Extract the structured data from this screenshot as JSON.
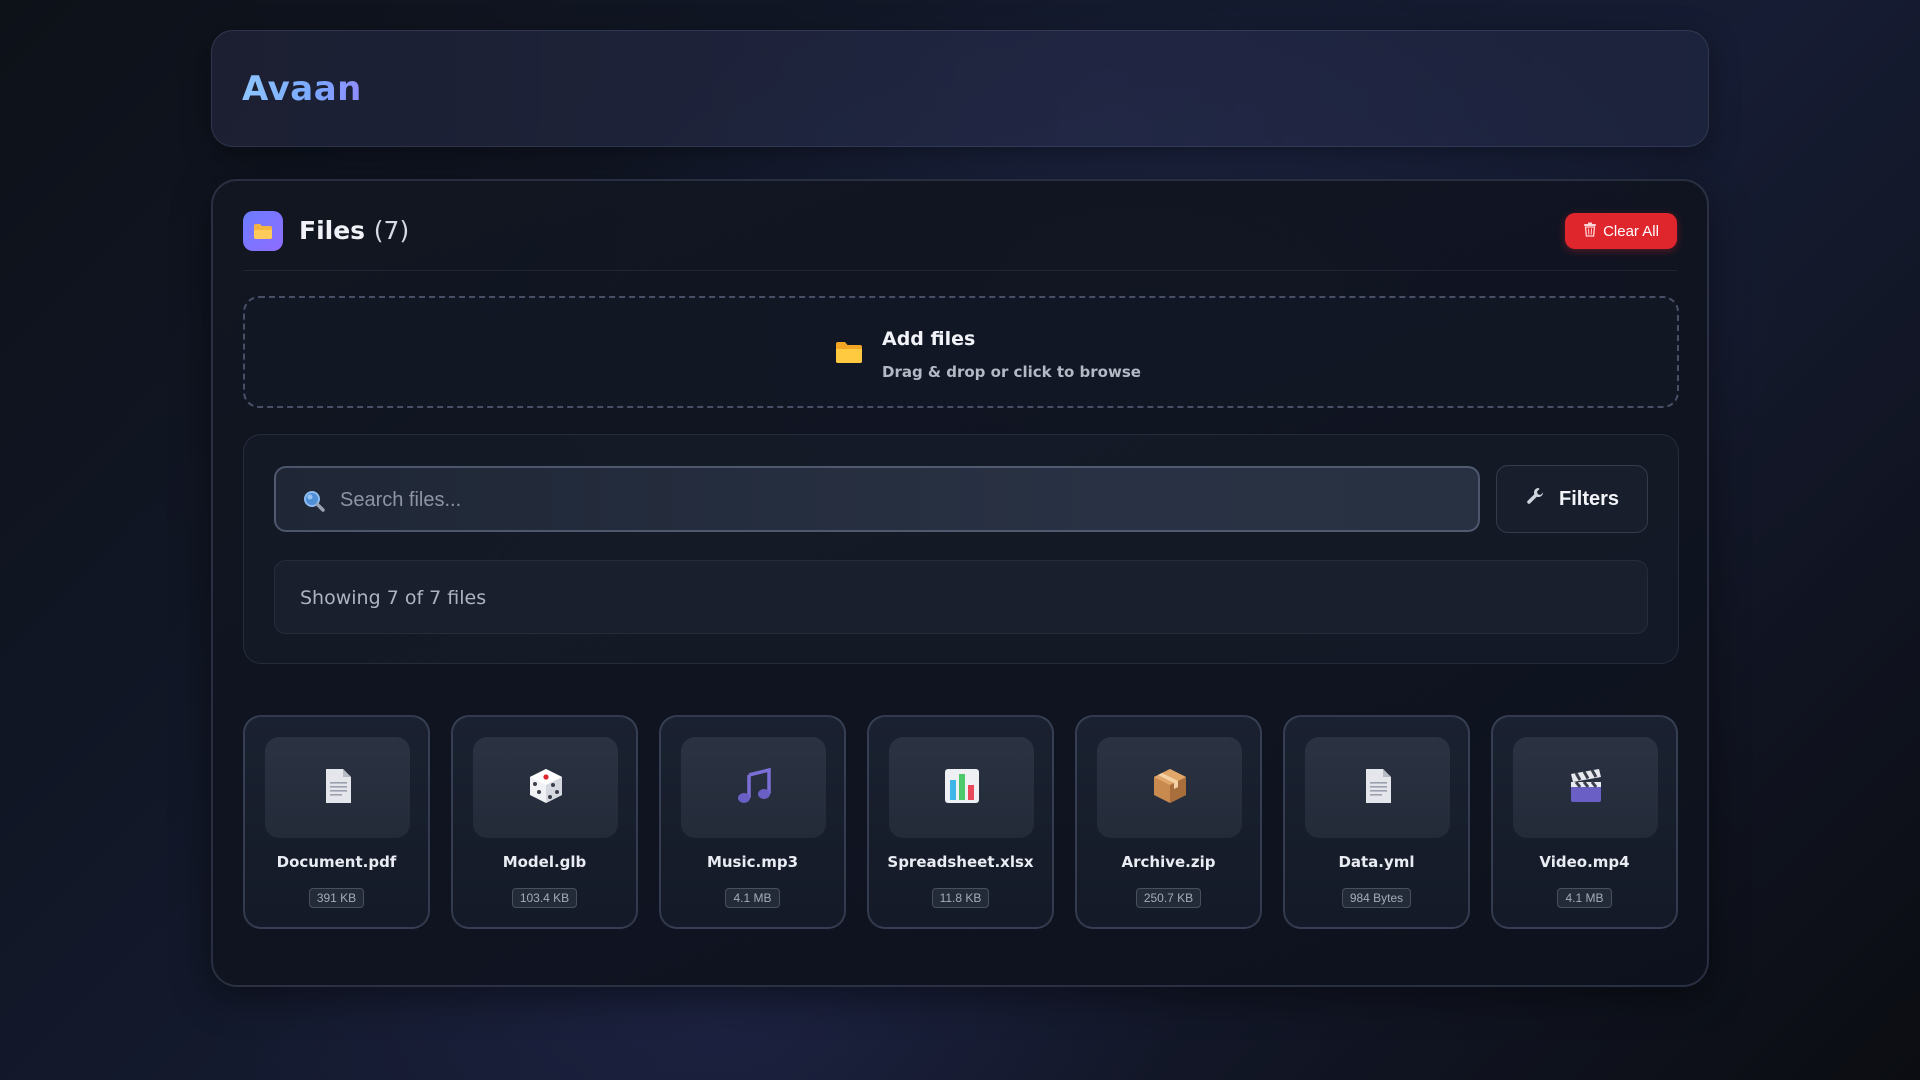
{
  "app": {
    "brand": "Avaan"
  },
  "header_files": {
    "title": "Files",
    "count": "(7)",
    "clear_all_label": "Clear All"
  },
  "dropzone": {
    "title": "Add files",
    "subtitle": "Drag & drop or click to browse"
  },
  "search": {
    "placeholder": "Search files...",
    "value": "",
    "filters_label": "Filters"
  },
  "status": {
    "showing_text": "Showing 7 of 7 files"
  },
  "files": [
    {
      "name": "Document.pdf",
      "size": "391 KB",
      "icon": "document-icon"
    },
    {
      "name": "Model.glb",
      "size": "103.4 KB",
      "icon": "dice-icon"
    },
    {
      "name": "Music.mp3",
      "size": "4.1 MB",
      "icon": "music-note-icon"
    },
    {
      "name": "Spreadsheet.xlsx",
      "size": "11.8 KB",
      "icon": "bar-chart-icon"
    },
    {
      "name": "Archive.zip",
      "size": "250.7 KB",
      "icon": "package-icon"
    },
    {
      "name": "Data.yml",
      "size": "984 Bytes",
      "icon": "document-icon"
    },
    {
      "name": "Video.mp4",
      "size": "4.1 MB",
      "icon": "clapper-icon"
    }
  ],
  "colors": {
    "accent": "#7aa8ff",
    "danger": "#e0262d",
    "folder": "#f7b733",
    "badge_gradient_start": "#6b7dff",
    "badge_gradient_end": "#8f6cff"
  }
}
